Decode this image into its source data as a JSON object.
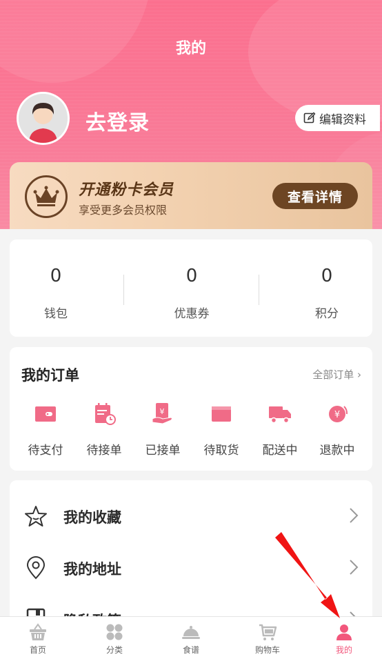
{
  "header": {
    "title": "我的"
  },
  "profile": {
    "login_label": "去登录",
    "edit_label": "编辑资料"
  },
  "vip": {
    "title": "开通粉卡会员",
    "subtitle": "享受更多会员权限",
    "button": "查看详情"
  },
  "stats": [
    {
      "value": "0",
      "label": "钱包"
    },
    {
      "value": "0",
      "label": "优惠券"
    },
    {
      "value": "0",
      "label": "积分"
    }
  ],
  "orders": {
    "title": "我的订单",
    "all_label": "全部订单 ›",
    "items": [
      {
        "label": "待支付",
        "icon": "wallet-icon"
      },
      {
        "label": "待接单",
        "icon": "calendar-clock-icon"
      },
      {
        "label": "已接单",
        "icon": "hand-receipt-icon"
      },
      {
        "label": "待取货",
        "icon": "package-icon"
      },
      {
        "label": "配送中",
        "icon": "truck-icon"
      },
      {
        "label": "退款中",
        "icon": "refund-yen-icon"
      }
    ]
  },
  "menu": [
    {
      "label": "我的收藏",
      "icon": "star-icon"
    },
    {
      "label": "我的地址",
      "icon": "location-pin-icon"
    },
    {
      "label": "隐私政策",
      "icon": "document-icon"
    }
  ],
  "tabbar": [
    {
      "label": "首页",
      "icon": "basket-icon"
    },
    {
      "label": "分类",
      "icon": "grid-icon"
    },
    {
      "label": "食谱",
      "icon": "cloche-icon"
    },
    {
      "label": "购物车",
      "icon": "cart-icon"
    },
    {
      "label": "我的",
      "icon": "user-icon",
      "active": true
    }
  ],
  "colors": {
    "brand": "#f97a97",
    "accent": "#f2577c",
    "vip_dark": "#6d4523"
  }
}
